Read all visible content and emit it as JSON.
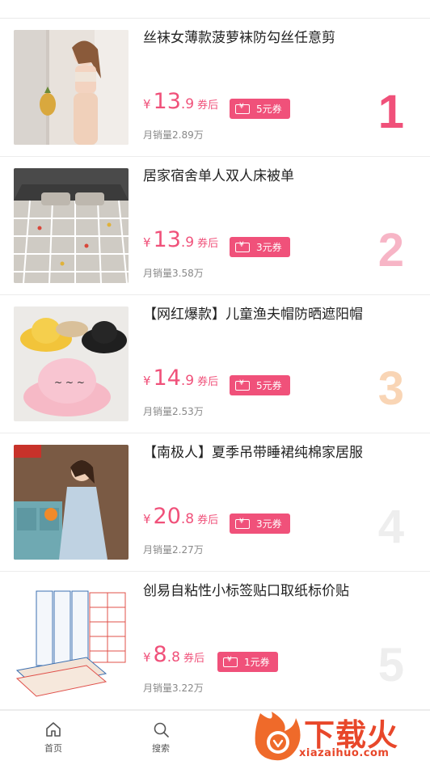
{
  "products": [
    {
      "title": "丝袜女薄款菠萝袜防勾丝任意剪",
      "price_int": "13",
      "price_dec": ".9",
      "after_label": "券后",
      "coupon": "5元券",
      "sales": "月销量2.89万",
      "rank": "1",
      "rank_color": "#f0517a",
      "thumb": "woman-lingerie-photo"
    },
    {
      "title": "居家宿舍单人双人床被单",
      "price_int": "13",
      "price_dec": ".9",
      "after_label": "券后",
      "coupon": "3元券",
      "sales": "月销量3.58万",
      "rank": "2",
      "rank_color": "#f7b5c6",
      "thumb": "bed-sheet-photo"
    },
    {
      "title": "【网红爆款】儿童渔夫帽防晒遮阳帽",
      "price_int": "14",
      "price_dec": ".9",
      "after_label": "券后",
      "coupon": "5元券",
      "sales": "月销量2.53万",
      "rank": "3",
      "rank_color": "#f9d5b5",
      "thumb": "kids-hats-photo"
    },
    {
      "title": "【南极人】夏季吊带睡裙纯棉家居服",
      "price_int": "20",
      "price_dec": ".8",
      "after_label": "券后",
      "coupon": "3元券",
      "sales": "月销量2.27万",
      "rank": "4",
      "rank_color": "#eeeeee",
      "thumb": "nightdress-photo"
    },
    {
      "title": "创易自粘性小标签贴口取纸标价贴",
      "price_int": "8",
      "price_dec": ".8",
      "after_label": "券后",
      "coupon": "1元券",
      "sales": "月销量3.22万",
      "rank": "5",
      "rank_color": "#eeeeee",
      "thumb": "label-stickers-photo"
    }
  ],
  "currency_symbol": "¥",
  "tabs": [
    {
      "label": "首页",
      "icon": "home-icon"
    },
    {
      "label": "搜索",
      "icon": "search-icon"
    }
  ],
  "watermark": {
    "text": "下载火",
    "url": "xiazaihuo.com"
  },
  "colors": {
    "accent": "#f0517a",
    "watermark": "#e8472a"
  }
}
